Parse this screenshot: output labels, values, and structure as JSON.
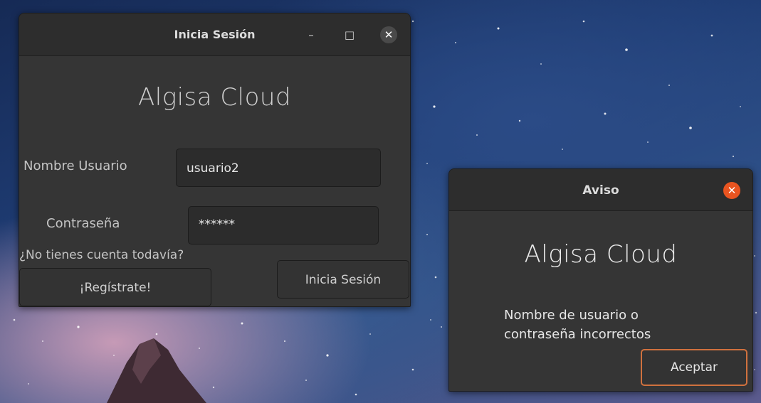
{
  "login_window": {
    "title": "Inicia Sesión",
    "minimize": "–",
    "maximize": "□",
    "close": "✕",
    "brand": "Algisa Cloud",
    "username_label": "Nombre Usuario",
    "username_value": "usuario2",
    "password_label": "Contraseña",
    "password_value": "******",
    "no_account_text": "¿No tienes cuenta todavía?",
    "register_button": "¡Regístrate!",
    "login_button": "Inicia Sesión"
  },
  "alert_dialog": {
    "title": "Aviso",
    "close": "✕",
    "brand": "Algisa Cloud",
    "message_line1": "Nombre de usuario o",
    "message_line2": "contraseña incorrectos",
    "accept_button": "Aceptar"
  },
  "colors": {
    "close_button_active": "#e95420",
    "accept_focus_border": "#d0713e"
  }
}
